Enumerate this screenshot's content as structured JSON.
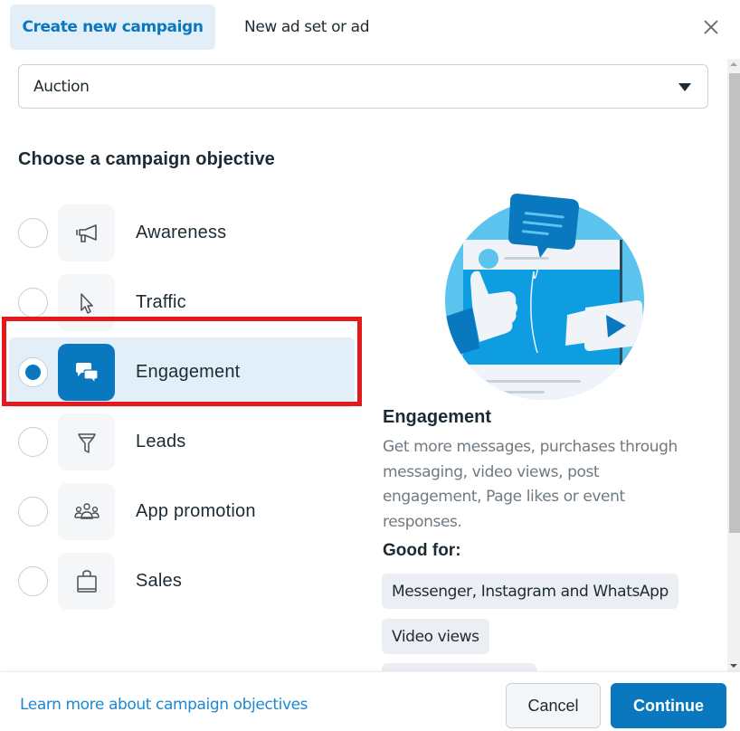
{
  "header": {
    "tabs": [
      {
        "label": "Create new campaign",
        "active": true
      },
      {
        "label": "New ad set or ad",
        "active": false
      }
    ],
    "close_icon": "close-icon"
  },
  "buying_type": {
    "selected": "Auction",
    "icon": "caret-down-icon"
  },
  "objectives": {
    "title": "Choose a campaign objective",
    "selected": "Engagement",
    "items": [
      {
        "label": "Awareness",
        "icon": "megaphone-icon",
        "selected": false
      },
      {
        "label": "Traffic",
        "icon": "cursor-icon",
        "selected": false
      },
      {
        "label": "Engagement",
        "icon": "chat-bubbles-icon",
        "selected": true
      },
      {
        "label": "Leads",
        "icon": "funnel-icon",
        "selected": false
      },
      {
        "label": "App promotion",
        "icon": "people-icon",
        "selected": false
      },
      {
        "label": "Sales",
        "icon": "shopping-bag-icon",
        "selected": false
      }
    ]
  },
  "detail": {
    "title": "Engagement",
    "description": "Get more messages, purchases through messaging, video views, post engagement, Page likes or event responses.",
    "good_for_label": "Good for:",
    "chips": [
      "Messenger, Instagram and WhatsApp",
      "Video views",
      ""
    ]
  },
  "footer": {
    "learn_more": "Learn more about campaign objectives",
    "cancel": "Cancel",
    "continue": "Continue"
  },
  "colors": {
    "accent": "#0a78be",
    "selected_row_bg": "#e2eef8",
    "highlight_border": "#e3191c",
    "link": "#1d88cf"
  }
}
